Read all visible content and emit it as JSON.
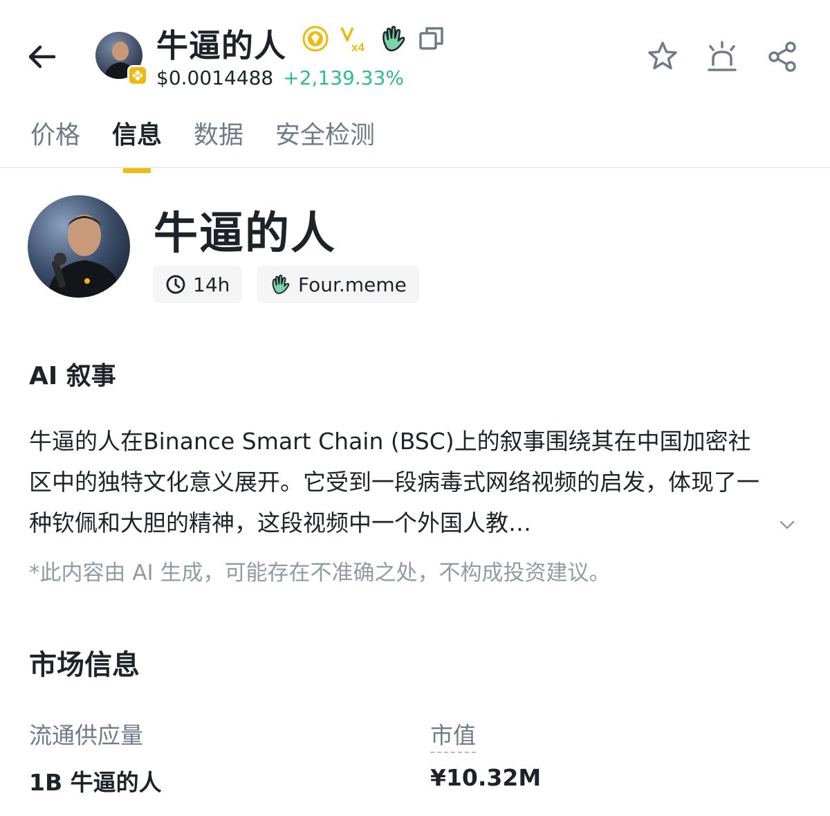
{
  "header": {
    "title": "牛逼的人",
    "price": "$0.0014488",
    "change": "+2,139.33%",
    "icons": [
      "back-arrow-icon",
      "gold-medal-icon",
      "verified-x4-icon",
      "four-meme-hand-icon",
      "copy-icon",
      "star-icon",
      "alert-siren-icon",
      "share-icon"
    ],
    "badge_text": "x4"
  },
  "tabs": [
    {
      "label": "价格",
      "active": false
    },
    {
      "label": "信息",
      "active": true
    },
    {
      "label": "数据",
      "active": false
    },
    {
      "label": "安全检测",
      "active": false
    }
  ],
  "token": {
    "name": "牛逼的人",
    "age": "14h",
    "platform": "Four.meme"
  },
  "ai": {
    "title": "AI 叙事",
    "text": "牛逼的人在Binance Smart Chain (BSC)上的叙事围绕其在中国加密社区中的独特文化意义展开。它受到一段病毒式网络视频的启发，体现了一种钦佩和大胆的精神，这段视频中一个外国人教…",
    "disclaimer": "*此内容由 AI 生成，可能存在不准确之处，不构成投资建议。"
  },
  "market": {
    "title": "市场信息",
    "supply_label": "流通供应量",
    "supply_value": "1B 牛逼的人",
    "mcap_label": "市值",
    "mcap_value": "¥10.32M"
  },
  "colors": {
    "accent": "#f0b90b",
    "positive": "#2ebd85",
    "text_primary": "#1e2329",
    "text_secondary": "#707a8a",
    "four_meme_green": "#7dd3a8"
  }
}
